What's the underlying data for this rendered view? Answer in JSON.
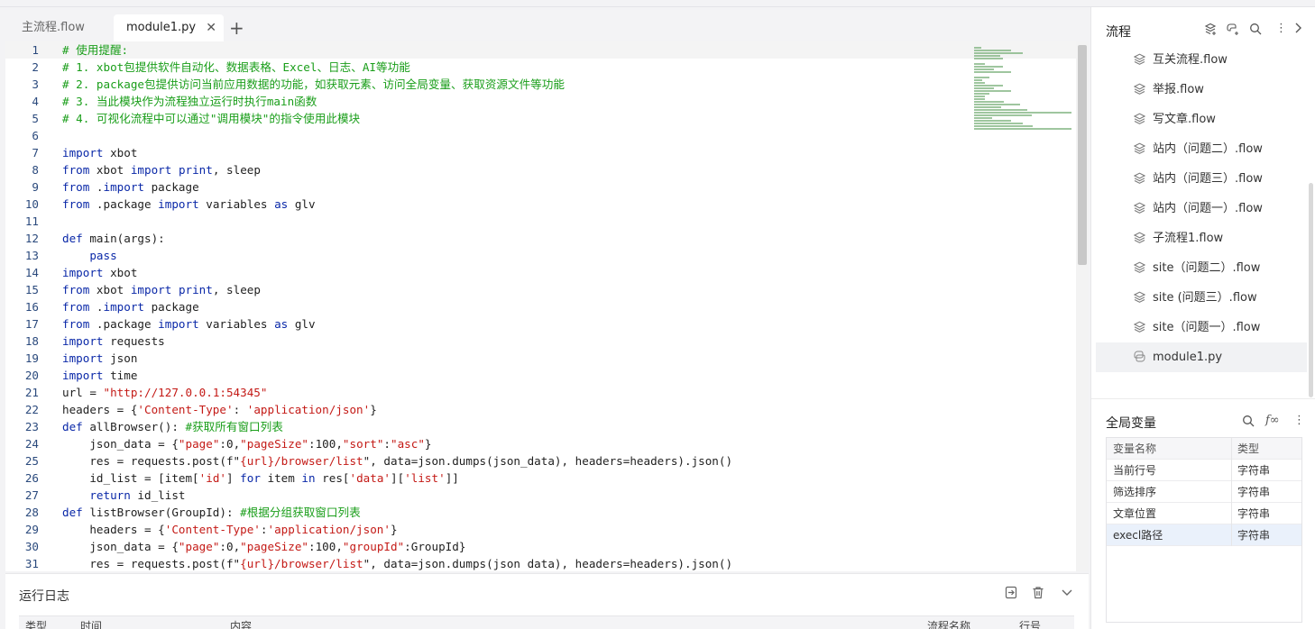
{
  "tabs": [
    {
      "label": "主流程.flow",
      "active": false
    },
    {
      "label": "module1.py",
      "active": true
    }
  ],
  "tab_close": "✕",
  "tab_add": "+",
  "code_lines": [
    [
      {
        "t": "# 使用提醒:",
        "c": "cm"
      }
    ],
    [
      {
        "t": "# 1. xbot包提供软件自动化、数据表格、Excel、日志、AI等功能",
        "c": "cm"
      }
    ],
    [
      {
        "t": "# 2. package包提供访问当前应用数据的功能，如获取元素、访问全局变量、获取资源文件等功能",
        "c": "cm"
      }
    ],
    [
      {
        "t": "# 3. 当此模块作为流程独立运行时执行main函数",
        "c": "cm"
      }
    ],
    [
      {
        "t": "# 4. 可视化流程中可以通过\"调用模块\"的指令使用此模块",
        "c": "cm"
      }
    ],
    [],
    [
      {
        "t": "import",
        "c": "kw"
      },
      {
        "t": " xbot"
      }
    ],
    [
      {
        "t": "from",
        "c": "kw"
      },
      {
        "t": " xbot "
      },
      {
        "t": "import",
        "c": "kw"
      },
      {
        "t": " "
      },
      {
        "t": "print",
        "c": "kw"
      },
      {
        "t": ", sleep"
      }
    ],
    [
      {
        "t": "from",
        "c": "kw"
      },
      {
        "t": " ."
      },
      {
        "t": "import",
        "c": "kw"
      },
      {
        "t": " package"
      }
    ],
    [
      {
        "t": "from",
        "c": "kw"
      },
      {
        "t": " .package "
      },
      {
        "t": "import",
        "c": "kw"
      },
      {
        "t": " variables "
      },
      {
        "t": "as",
        "c": "kw"
      },
      {
        "t": " glv"
      }
    ],
    [],
    [
      {
        "t": "def",
        "c": "kw"
      },
      {
        "t": " main(args):"
      }
    ],
    [
      {
        "t": "    "
      },
      {
        "t": "pass",
        "c": "kw"
      }
    ],
    [
      {
        "t": "import",
        "c": "kw"
      },
      {
        "t": " xbot"
      }
    ],
    [
      {
        "t": "from",
        "c": "kw"
      },
      {
        "t": " xbot "
      },
      {
        "t": "import",
        "c": "kw"
      },
      {
        "t": " "
      },
      {
        "t": "print",
        "c": "kw"
      },
      {
        "t": ", sleep"
      }
    ],
    [
      {
        "t": "from",
        "c": "kw"
      },
      {
        "t": " ."
      },
      {
        "t": "import",
        "c": "kw"
      },
      {
        "t": " package"
      }
    ],
    [
      {
        "t": "from",
        "c": "kw"
      },
      {
        "t": " .package "
      },
      {
        "t": "import",
        "c": "kw"
      },
      {
        "t": " variables "
      },
      {
        "t": "as",
        "c": "kw"
      },
      {
        "t": " glv"
      }
    ],
    [
      {
        "t": "import",
        "c": "kw"
      },
      {
        "t": " requests"
      }
    ],
    [
      {
        "t": "import",
        "c": "kw"
      },
      {
        "t": " json"
      }
    ],
    [
      {
        "t": "import",
        "c": "kw"
      },
      {
        "t": " time"
      }
    ],
    [
      {
        "t": "url = "
      },
      {
        "t": "\"http://127.0.0.1:54345\"",
        "c": "st"
      }
    ],
    [
      {
        "t": "headers = {"
      },
      {
        "t": "'Content-Type'",
        "c": "st"
      },
      {
        "t": ": "
      },
      {
        "t": "'application/json'",
        "c": "st"
      },
      {
        "t": "}"
      }
    ],
    [
      {
        "t": "def",
        "c": "kw"
      },
      {
        "t": " allBrowser(): "
      },
      {
        "t": "#获取所有窗口列表",
        "c": "cm"
      }
    ],
    [
      {
        "t": "    json_data = {"
      },
      {
        "t": "\"page\"",
        "c": "st"
      },
      {
        "t": ":0,"
      },
      {
        "t": "\"pageSize\"",
        "c": "st"
      },
      {
        "t": ":100,"
      },
      {
        "t": "\"sort\"",
        "c": "st"
      },
      {
        "t": ":"
      },
      {
        "t": "\"asc\"",
        "c": "st"
      },
      {
        "t": "}"
      }
    ],
    [
      {
        "t": "    res = requests.post(f\""
      },
      {
        "t": "{url}/browser/list",
        "c": "st"
      },
      {
        "t": "\", data=json.dumps(json_data), headers=headers).json()"
      }
    ],
    [
      {
        "t": "    id_list = [item["
      },
      {
        "t": "'id'",
        "c": "st"
      },
      {
        "t": "] "
      },
      {
        "t": "for",
        "c": "kw"
      },
      {
        "t": " item "
      },
      {
        "t": "in",
        "c": "kw"
      },
      {
        "t": " res["
      },
      {
        "t": "'data'",
        "c": "st"
      },
      {
        "t": "]["
      },
      {
        "t": "'list'",
        "c": "st"
      },
      {
        "t": "]]"
      }
    ],
    [
      {
        "t": "    "
      },
      {
        "t": "return",
        "c": "kw"
      },
      {
        "t": " id_list"
      }
    ],
    [
      {
        "t": "def",
        "c": "kw"
      },
      {
        "t": " listBrowser(GroupId): "
      },
      {
        "t": "#根据分组获取窗口列表",
        "c": "cm"
      }
    ],
    [
      {
        "t": "    headers = {"
      },
      {
        "t": "'Content-Type'",
        "c": "st"
      },
      {
        "t": ":"
      },
      {
        "t": "'application/json'",
        "c": "st"
      },
      {
        "t": "}"
      }
    ],
    [
      {
        "t": "    json_data = {"
      },
      {
        "t": "\"page\"",
        "c": "st"
      },
      {
        "t": ":0,"
      },
      {
        "t": "\"pageSize\"",
        "c": "st"
      },
      {
        "t": ":100,"
      },
      {
        "t": "\"groupId\"",
        "c": "st"
      },
      {
        "t": ":GroupId}"
      }
    ],
    [
      {
        "t": "    res = requests.post(f\""
      },
      {
        "t": "{url}/browser/list",
        "c": "st"
      },
      {
        "t": "\", data=json.dumps(json data), headers=headers).json()"
      }
    ]
  ],
  "log": {
    "title": "运行日志",
    "columns": [
      "类型",
      "时间",
      "内容",
      "流程名称",
      "行号"
    ]
  },
  "flows": {
    "title": "流程",
    "items": [
      "互关流程.flow",
      "举报.flow",
      "写文章.flow",
      "站内（问题二）.flow",
      "站内（问题三）.flow",
      "站内（问题一）.flow",
      "子流程1.flow",
      "site（问题二）.flow",
      "site (问题三）.flow",
      "site（问题一）.flow",
      "module1.py"
    ],
    "selected_index": 10
  },
  "globals": {
    "title": "全局变量",
    "columns": [
      "变量名称",
      "类型"
    ],
    "rows": [
      [
        "当前行号",
        "字符串"
      ],
      [
        "筛选排序",
        "字符串"
      ],
      [
        "文章位置",
        "字符串"
      ],
      [
        "execl路径",
        "字符串"
      ]
    ],
    "selected_index": 3
  }
}
